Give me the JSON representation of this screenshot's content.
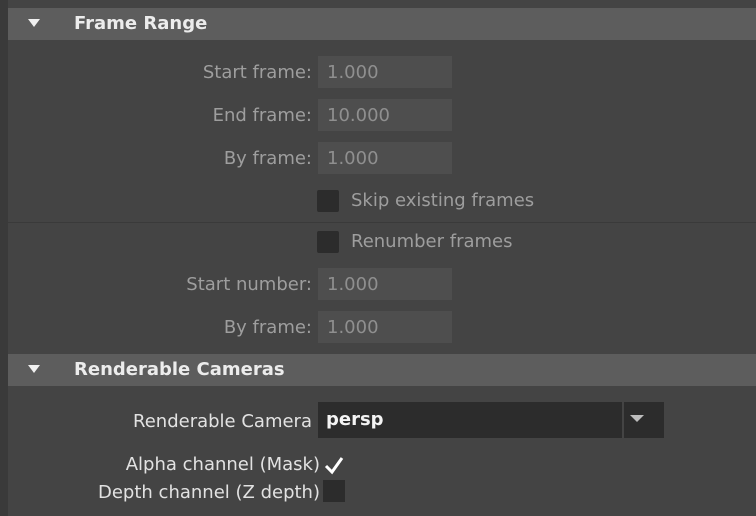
{
  "frame_range": {
    "title": "Frame Range",
    "start_frame_label": "Start frame:",
    "start_frame_value": "1.000",
    "end_frame_label": "End frame:",
    "end_frame_value": "10.000",
    "by_frame_label": "By frame:",
    "by_frame_value": "1.000",
    "skip_existing_label": "Skip existing frames",
    "skip_existing_checked": false,
    "renumber_label": "Renumber frames",
    "renumber_checked": false,
    "start_number_label": "Start number:",
    "start_number_value": "1.000",
    "by_frame2_label": "By frame:",
    "by_frame2_value": "1.000"
  },
  "renderable_cameras": {
    "title": "Renderable Cameras",
    "camera_label": "Renderable Camera",
    "camera_value": "persp",
    "alpha_label": "Alpha channel (Mask)",
    "alpha_checked": true,
    "depth_label": "Depth channel (Z depth)",
    "depth_checked": false
  },
  "icons": {
    "section_toggle": "collapse-triangle-icon",
    "dropdown": "chevron-down-icon",
    "check": "checkmark-icon"
  },
  "colors": {
    "background": "#444444",
    "header": "#5d5d5d",
    "field": "#4e4e4e",
    "checkbox": "#2c2c2c",
    "label_dim": "#9e9e9e",
    "label_bright": "#e2e2e2"
  }
}
